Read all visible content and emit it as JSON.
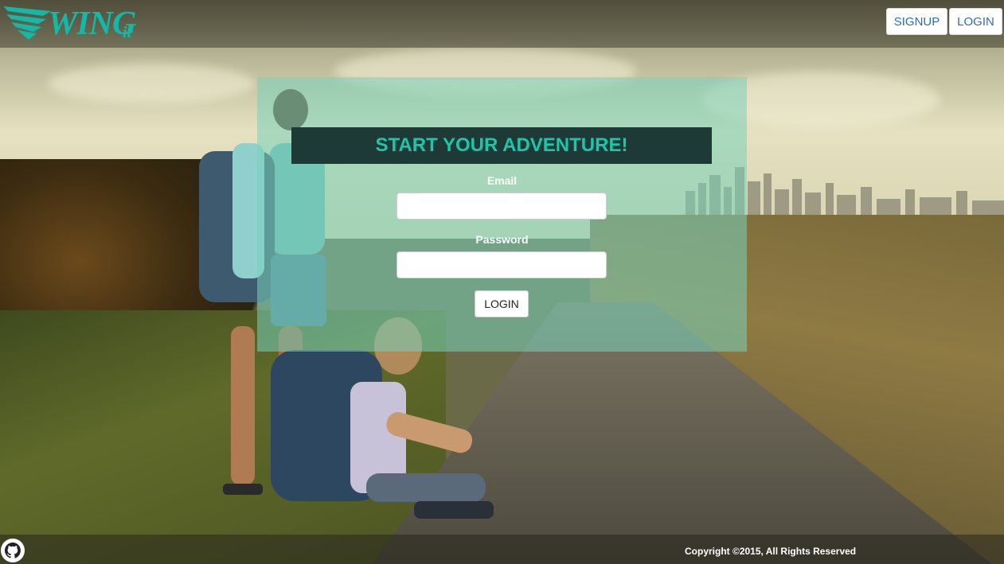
{
  "header": {
    "logo_text": "WING",
    "logo_suffix": "it",
    "signup_label": "SIGNUP",
    "login_label": "LOGIN"
  },
  "card": {
    "title": "START YOUR ADVENTURE!",
    "email_label": "Email",
    "email_value": "",
    "password_label": "Password",
    "password_value": "",
    "login_label": "LOGIN"
  },
  "footer": {
    "copyright": "Copyright ©2015, All Rights Reserved",
    "github_icon": "github-icon"
  },
  "colors": {
    "accent": "#1cc6aa",
    "title_bg": "#1e3a36",
    "nav_text": "#2f6fa8"
  }
}
